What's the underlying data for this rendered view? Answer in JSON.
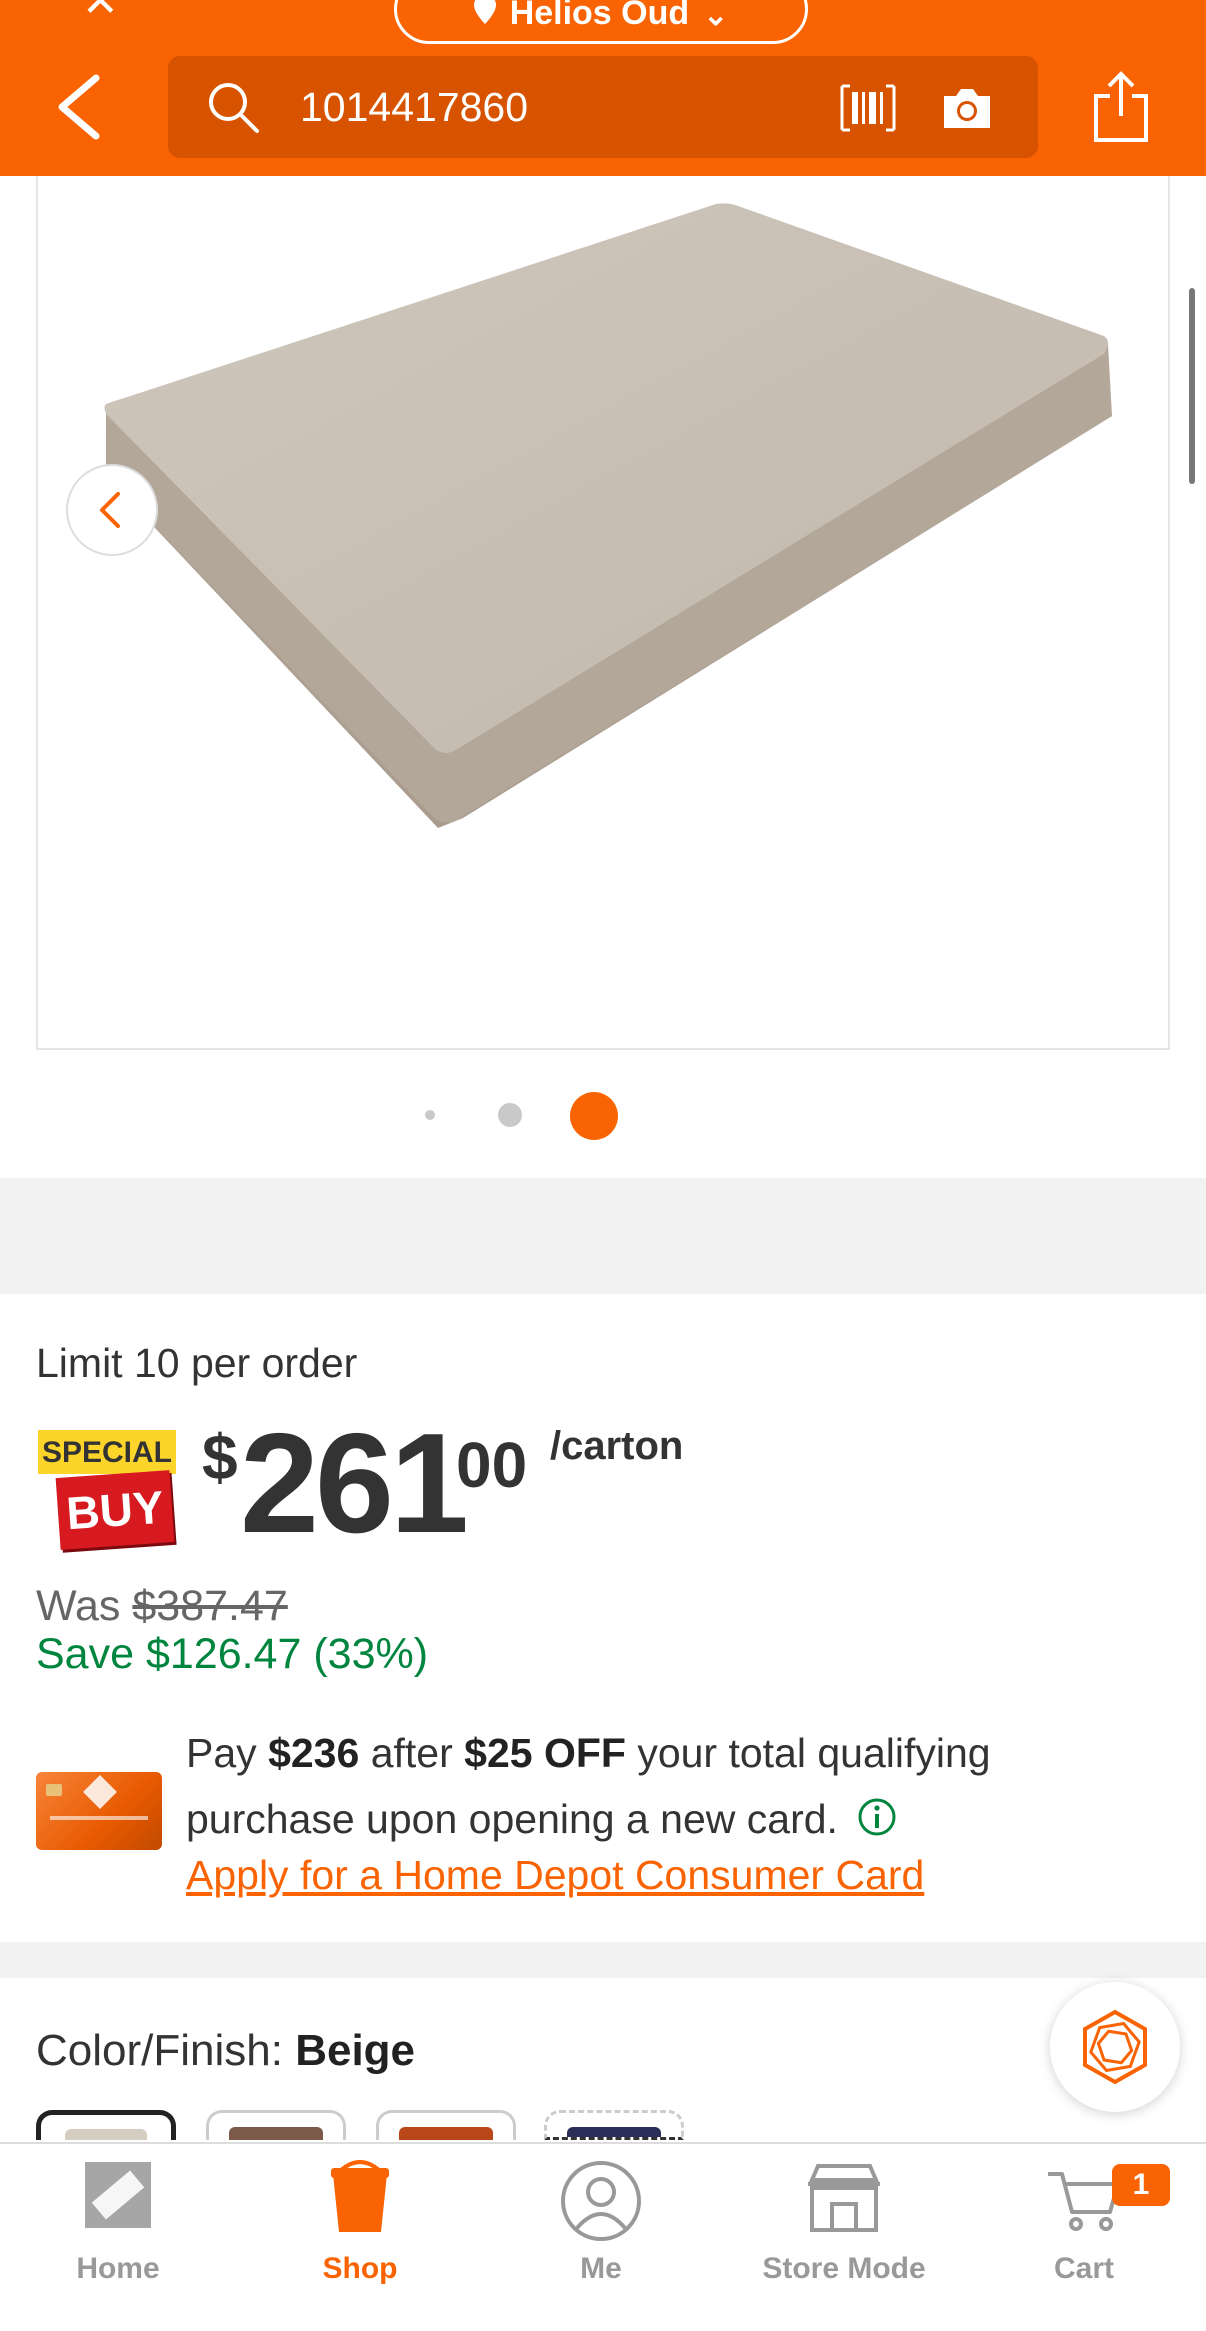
{
  "header": {
    "store_label": "Helios Oud",
    "search_value": "1014417860"
  },
  "product": {
    "image_alt": "Beige outdoor cushion",
    "gallery_count": 3,
    "gallery_active_index": 3
  },
  "pricing": {
    "limit_text": "Limit 10 per order",
    "special_top": "SPECIAL",
    "special_bottom": "BUY",
    "currency": "$",
    "dollars": "261",
    "cents": "00",
    "unit": "/carton",
    "was_label": "Was",
    "was_price": "$387.47",
    "save_text": "Save $126.47 (33%)"
  },
  "credit_offer": {
    "text_pay": "Pay",
    "amount": "$236",
    "text_after": "after",
    "discount": "$25 OFF",
    "text_rest": "your total qualifying purchase upon opening a new card.",
    "apply_link": "Apply for a Home Depot Consumer Card"
  },
  "color_finish": {
    "label": "Color/Finish:",
    "value": "Beige"
  },
  "tabbar": {
    "items": [
      {
        "label": "Home",
        "icon": "home-depot-logo-icon"
      },
      {
        "label": "Shop",
        "icon": "shopping-bucket-icon",
        "active": true
      },
      {
        "label": "Me",
        "icon": "user-icon"
      },
      {
        "label": "Store Mode",
        "icon": "store-icon"
      },
      {
        "label": "Cart",
        "icon": "cart-icon"
      }
    ],
    "cart_count": "1"
  },
  "colors": {
    "brand_orange": "#f96302",
    "savings_green": "#00853e",
    "special_yellow": "#fdd52a",
    "special_red": "#d71920"
  }
}
